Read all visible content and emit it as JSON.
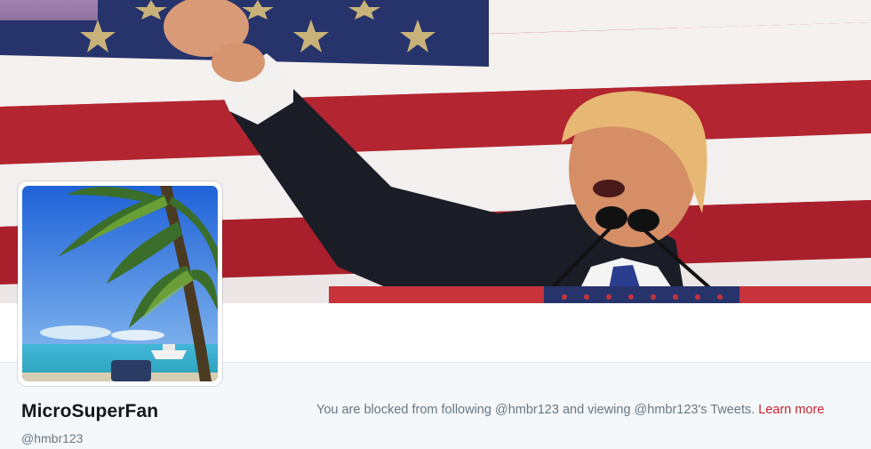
{
  "header": {
    "banner_description_icon": "flag-rally-banner-image"
  },
  "profile": {
    "avatar_icon": "palm-beach-avatar-image",
    "name": "MicroSuperFan",
    "handle": "@hmbr123"
  },
  "notice": {
    "text": "You are blocked from following @hmbr123 and viewing @hmbr123's Tweets.",
    "link_label": "Learn more"
  },
  "colors": {
    "link": "#c9242f",
    "muted_text": "#657786",
    "name_text": "#14171a"
  }
}
